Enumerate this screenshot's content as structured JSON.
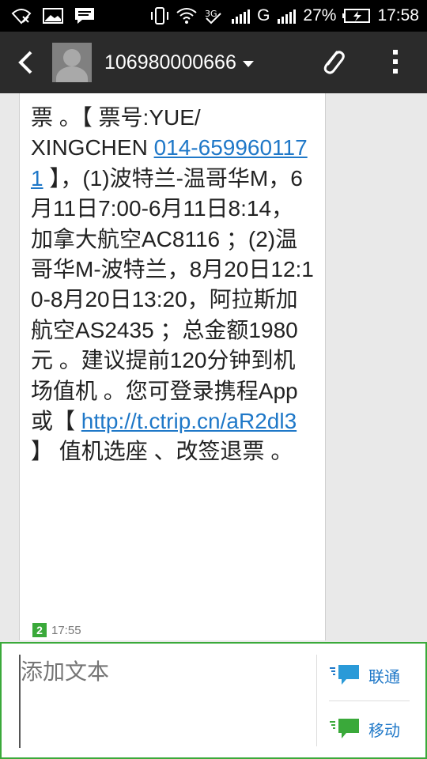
{
  "status_bar": {
    "network_g": "G",
    "battery_percent": "27%",
    "time": "17:58",
    "icons": [
      "no-sim-wifi-icon",
      "image-icon",
      "message-icon",
      "vibrate-icon",
      "wifi-icon",
      "3g-icon",
      "signal-icon",
      "signal-icon-2",
      "battery-icon"
    ]
  },
  "header": {
    "contact_name": "106980000666"
  },
  "message": {
    "lines_before_link1": "票 。【 票号:YUE/\nXINGCHEN ",
    "link1": "014-6599601171",
    "text_after_link1": " 】，(1)波特兰-温哥华M，6月11日7:00-6月11日8:14，加拿大航空AC8116 ；(2)温哥华M-波特兰，8月20日12:10-8月20日13:20，阿拉斯加航空AS2435 ；总金额1980元 。建议提前120分钟到机场值机 。您可登录携程App或【 ",
    "link2": "http://t.ctrip.cn/aR2dl3",
    "text_after_link2": " 】 值机选座 、改签退票 。",
    "sim_slot": "2",
    "time": "17:55"
  },
  "compose": {
    "placeholder": "添加文本",
    "send_buttons": [
      {
        "label": "联通"
      },
      {
        "label": "移动"
      }
    ]
  },
  "colors": {
    "accent_green": "#3aa93a",
    "link_blue": "#1f78c8",
    "actionbar": "#2b2b2b"
  }
}
